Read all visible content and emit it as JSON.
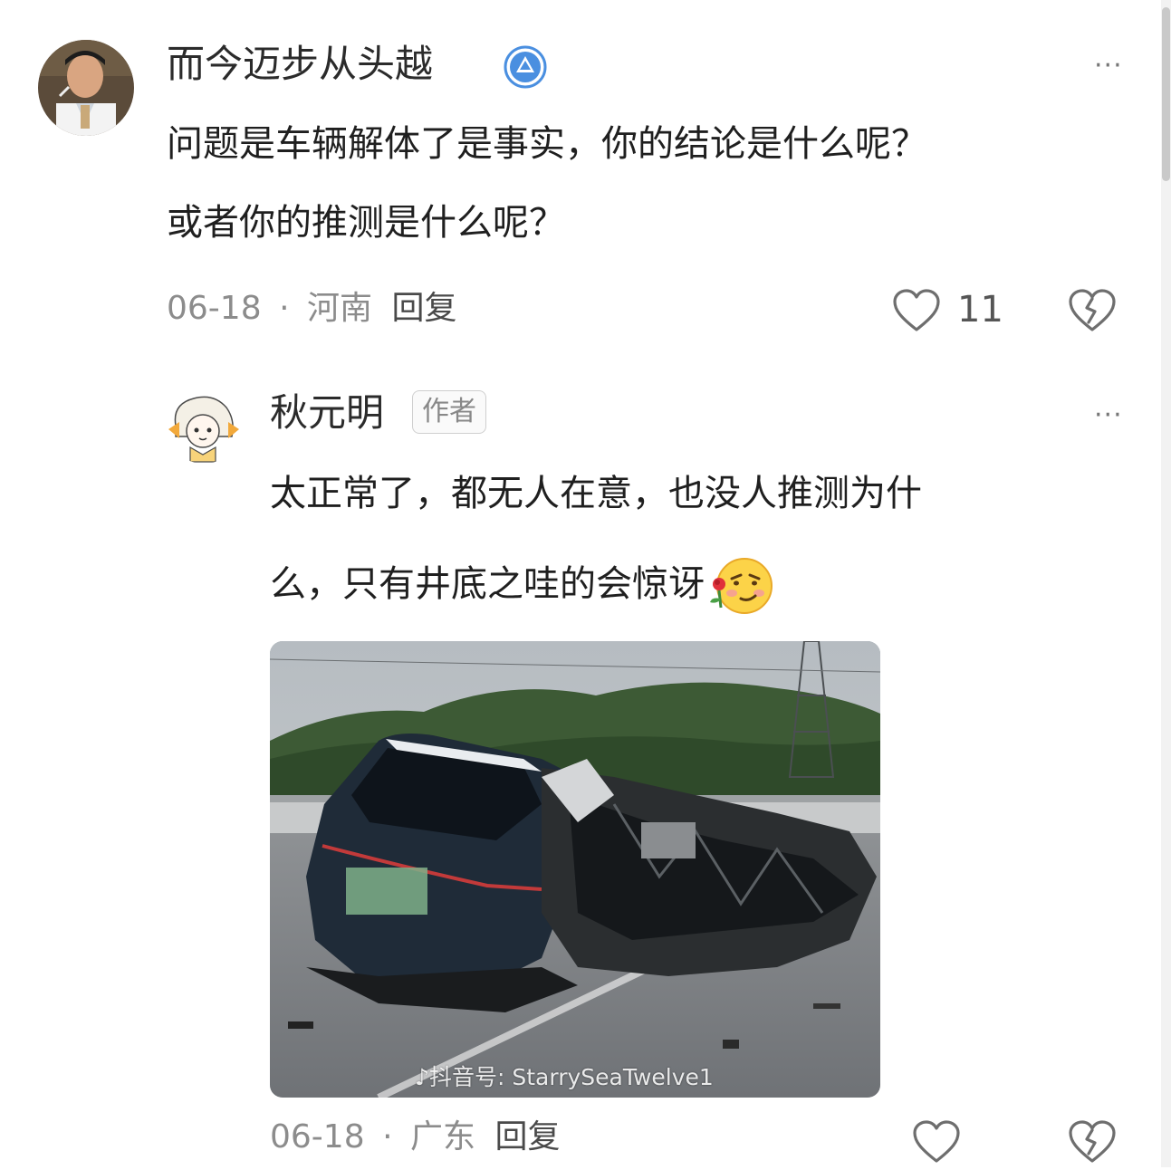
{
  "comment1": {
    "username": "而今迈步从头越",
    "content_lines": [
      "问题是车辆解体了是事实，你的结论是什么呢？",
      "或者你的推测是什么呢？"
    ],
    "date": "06-18",
    "dot": "·",
    "location": "河南",
    "reply_label": "回复",
    "like_count": "11",
    "more": "···"
  },
  "reply1": {
    "username": "秋元明",
    "badge": "作者",
    "content_lines": [
      "太正常了，都无人在意，也没人推测为什",
      "么，只有井底之哇的会惊讶"
    ],
    "image": {
      "watermark_platform": "抖音号:",
      "watermark_id": "StarrySeaTwelve1"
    },
    "date": "06-18",
    "dot": "·",
    "location": "广东",
    "reply_label": "回复",
    "more": "···"
  },
  "colors": {
    "verified_badge": "#4a8fe0",
    "meta_text": "#8c8c8c",
    "icon_stroke": "#6e6e6e"
  }
}
